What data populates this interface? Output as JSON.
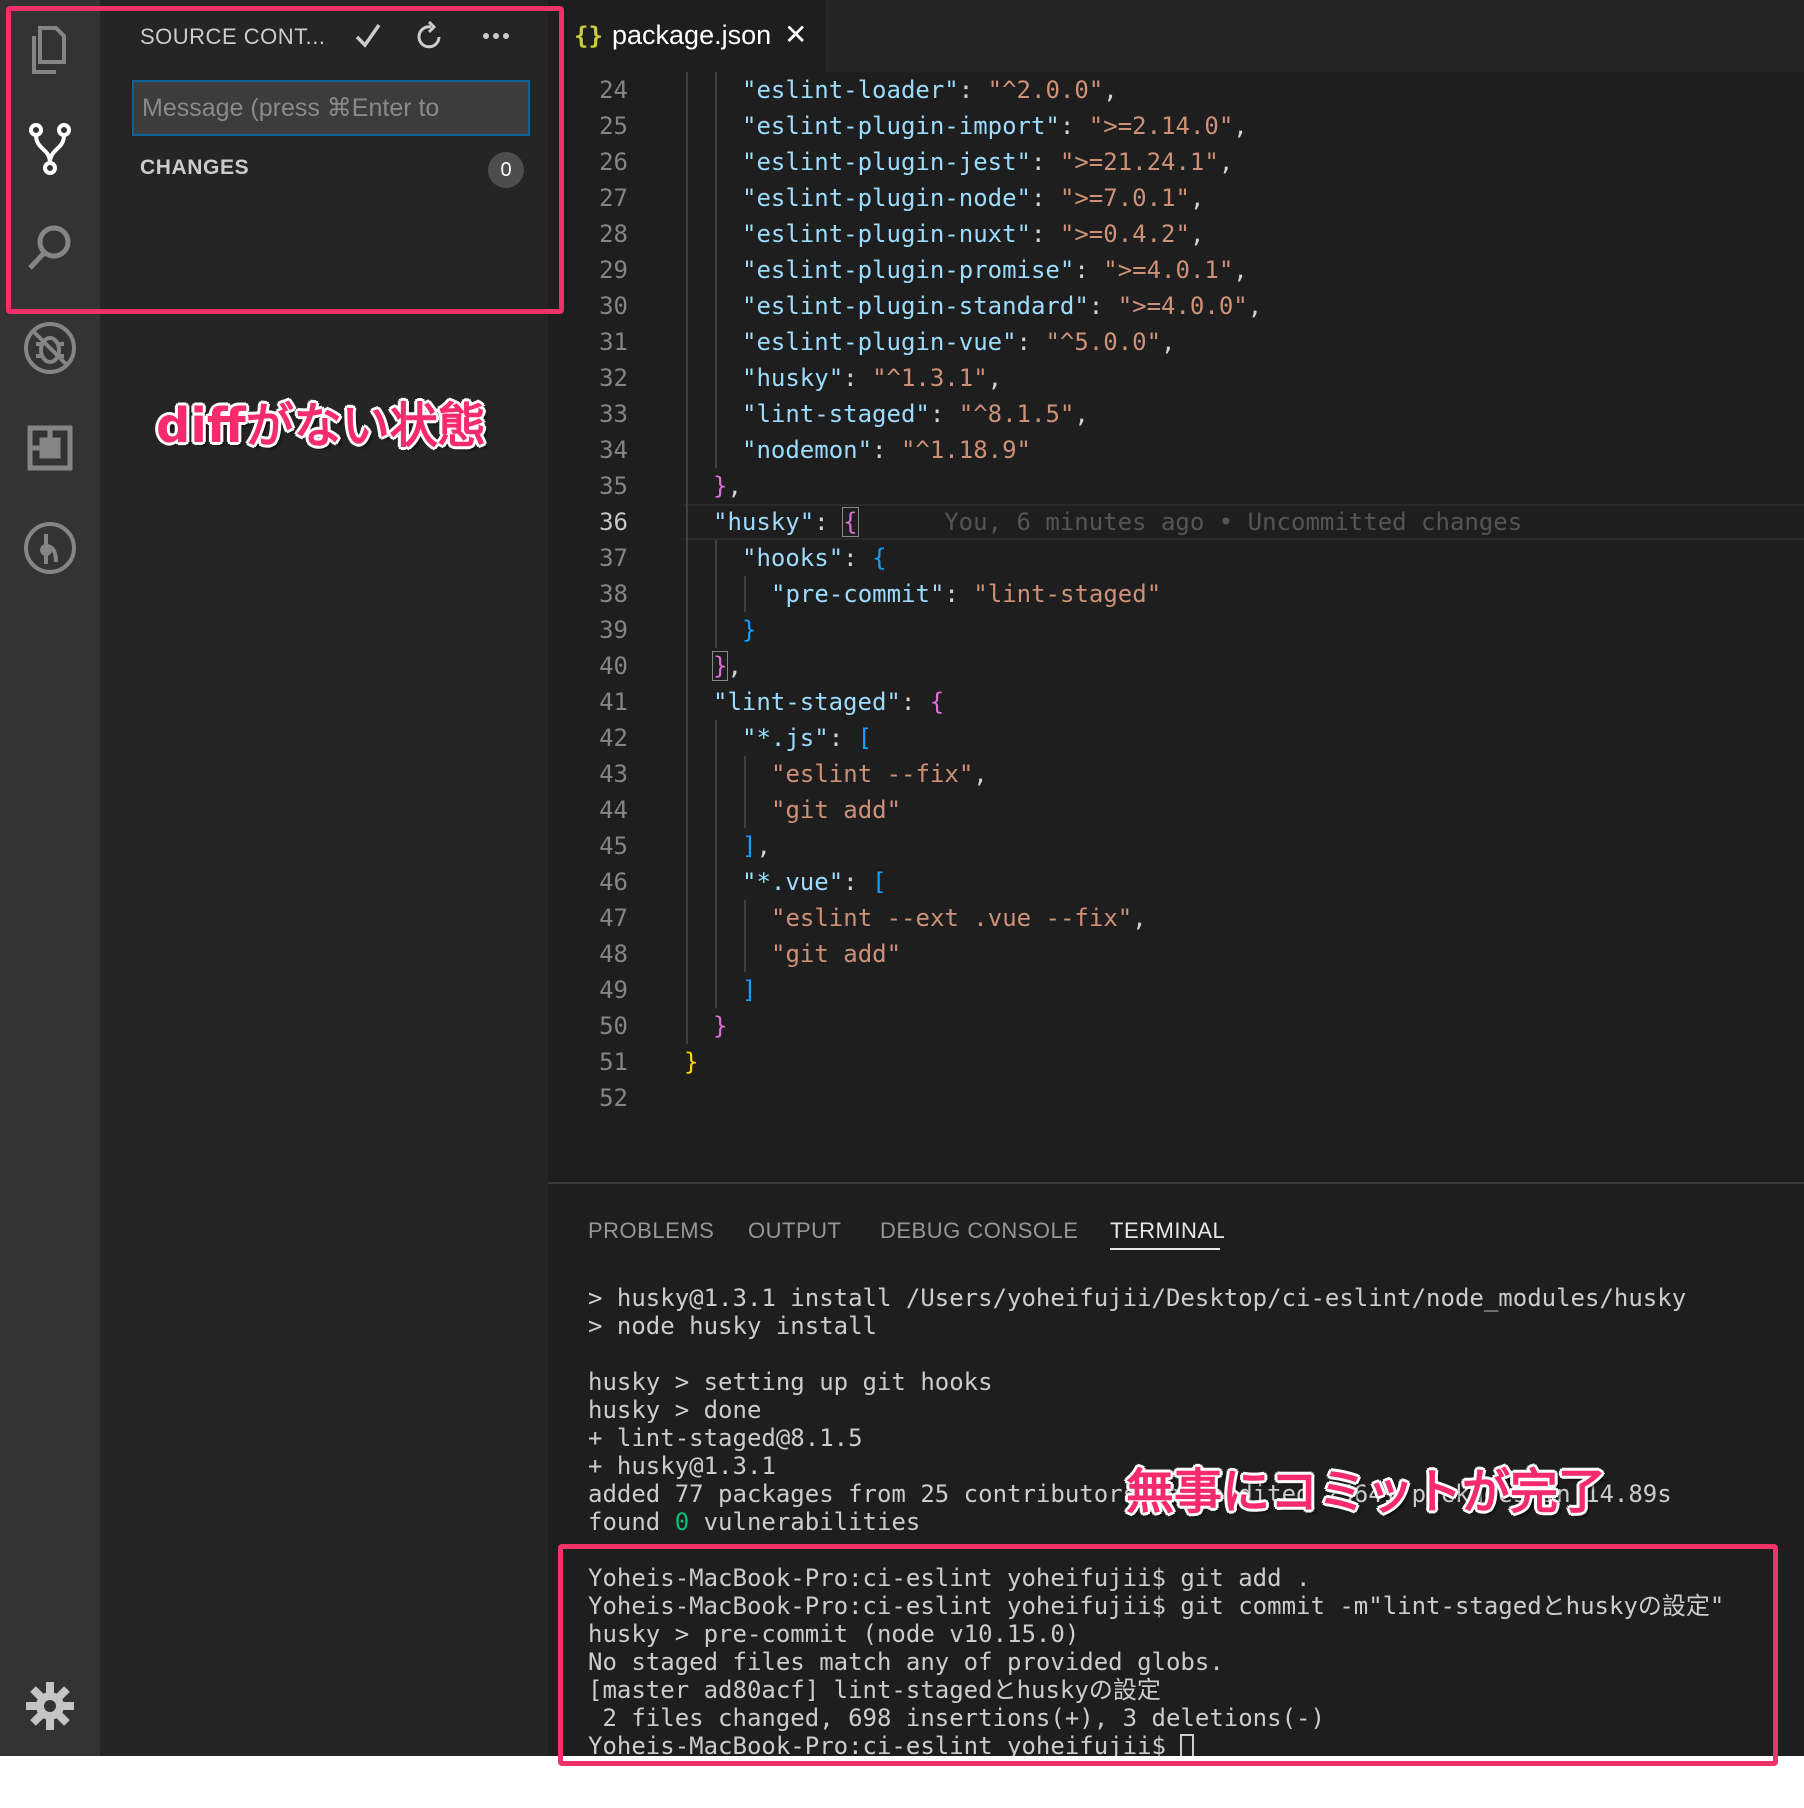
{
  "activity_bar": {
    "items": [
      {
        "name": "explorer-icon"
      },
      {
        "name": "source-control-icon"
      },
      {
        "name": "search-icon"
      },
      {
        "name": "debug-icon"
      },
      {
        "name": "extensions-icon"
      },
      {
        "name": "gitlens-icon"
      },
      {
        "name": "settings-gear-icon"
      }
    ]
  },
  "sidebar": {
    "title": "SOURCE CONT...",
    "commit_placeholder": "Message (press ⌘Enter to",
    "changes_label": "CHANGES",
    "changes_count": "0"
  },
  "tab": {
    "icon": "{}",
    "label": "package.json",
    "close": "✕"
  },
  "editor": {
    "current_line": 36,
    "blame_text": "You, 6 minutes ago • Uncommitted changes",
    "lines": [
      {
        "n": "24",
        "indent": 2,
        "key": "\"eslint-loader\"",
        "val": "\"^2.0.0\"",
        "end": ","
      },
      {
        "n": "25",
        "indent": 2,
        "key": "\"eslint-plugin-import\"",
        "val": "\">=2.14.0\"",
        "end": ","
      },
      {
        "n": "26",
        "indent": 2,
        "key": "\"eslint-plugin-jest\"",
        "val": "\">=21.24.1\"",
        "end": ","
      },
      {
        "n": "27",
        "indent": 2,
        "key": "\"eslint-plugin-node\"",
        "val": "\">=7.0.1\"",
        "end": ","
      },
      {
        "n": "28",
        "indent": 2,
        "key": "\"eslint-plugin-nuxt\"",
        "val": "\">=0.4.2\"",
        "end": ","
      },
      {
        "n": "29",
        "indent": 2,
        "key": "\"eslint-plugin-promise\"",
        "val": "\">=4.0.1\"",
        "end": ","
      },
      {
        "n": "30",
        "indent": 2,
        "key": "\"eslint-plugin-standard\"",
        "val": "\">=4.0.0\"",
        "end": ","
      },
      {
        "n": "31",
        "indent": 2,
        "key": "\"eslint-plugin-vue\"",
        "val": "\"^5.0.0\"",
        "end": ","
      },
      {
        "n": "32",
        "indent": 2,
        "key": "\"husky\"",
        "val": "\"^1.3.1\"",
        "end": ","
      },
      {
        "n": "33",
        "indent": 2,
        "key": "\"lint-staged\"",
        "val": "\"^8.1.5\"",
        "end": ","
      },
      {
        "n": "34",
        "indent": 2,
        "key": "\"nodemon\"",
        "val": "\"^1.18.9\"",
        "end": ""
      },
      {
        "n": "35",
        "indent": 1,
        "brace": "}",
        "bc": "b2",
        "end": ","
      },
      {
        "n": "36",
        "indent": 1,
        "key": "\"husky\"",
        "brace": "{",
        "bc": "b2",
        "boxed": true,
        "blame": true
      },
      {
        "n": "37",
        "indent": 2,
        "key": "\"hooks\"",
        "brace": "{",
        "bc": "b3"
      },
      {
        "n": "38",
        "indent": 3,
        "key": "\"pre-commit\"",
        "val": "\"lint-staged\"",
        "end": ""
      },
      {
        "n": "39",
        "indent": 2,
        "brace": "}",
        "bc": "b3"
      },
      {
        "n": "40",
        "indent": 1,
        "brace": "}",
        "bc": "b2",
        "boxed": true,
        "end": ","
      },
      {
        "n": "41",
        "indent": 1,
        "key": "\"lint-staged\"",
        "brace": "{",
        "bc": "b2"
      },
      {
        "n": "42",
        "indent": 2,
        "key": "\"*.js\"",
        "brace": "[",
        "bc": "b3"
      },
      {
        "n": "43",
        "indent": 3,
        "str": "\"eslint --fix\"",
        "end": ","
      },
      {
        "n": "44",
        "indent": 3,
        "str": "\"git add\"",
        "end": ""
      },
      {
        "n": "45",
        "indent": 2,
        "brace": "]",
        "bc": "b3",
        "end": ","
      },
      {
        "n": "46",
        "indent": 2,
        "key": "\"*.vue\"",
        "brace": "[",
        "bc": "b3"
      },
      {
        "n": "47",
        "indent": 3,
        "str": "\"eslint --ext .vue --fix\"",
        "end": ","
      },
      {
        "n": "48",
        "indent": 3,
        "str": "\"git add\"",
        "end": ""
      },
      {
        "n": "49",
        "indent": 2,
        "brace": "]",
        "bc": "b3"
      },
      {
        "n": "50",
        "indent": 1,
        "brace": "}",
        "bc": "b2"
      },
      {
        "n": "51",
        "indent": 0,
        "brace": "}",
        "bc": "b1"
      },
      {
        "n": "52",
        "indent": 0
      }
    ]
  },
  "panel": {
    "tabs": [
      "PROBLEMS",
      "OUTPUT",
      "DEBUG CONSOLE",
      "TERMINAL"
    ],
    "active_tab": "TERMINAL",
    "terminal_lines": [
      "> husky@1.3.1 install /Users/yoheifujii/Desktop/ci-eslint/node_modules/husky",
      "> node husky install",
      "",
      "husky > setting up git hooks",
      "husky > done",
      "+ lint-staged@8.1.5",
      "+ husky@1.3.1",
      "added 77 packages from 25 contributors and audited 25641 packages in 14.89s",
      "found 0 vulnerabilities",
      "",
      "Yoheis-MacBook-Pro:ci-eslint yoheifujii$ git add .",
      "Yoheis-MacBook-Pro:ci-eslint yoheifujii$ git commit -m\"lint-stagedとhuskyの設定\"",
      "husky > pre-commit (node v10.15.0)",
      "No staged files match any of provided globs.",
      "[master ad80acf] lint-stagedとhuskyの設定",
      " 2 files changed, 698 insertions(+), 3 deletions(-)",
      "Yoheis-MacBook-Pro:ci-eslint yoheifujii$ "
    ]
  },
  "annotations": {
    "no_diff": "diffがない状態",
    "commit_done": "無事にコミットが完了",
    "accent_color": "#f1316a"
  }
}
